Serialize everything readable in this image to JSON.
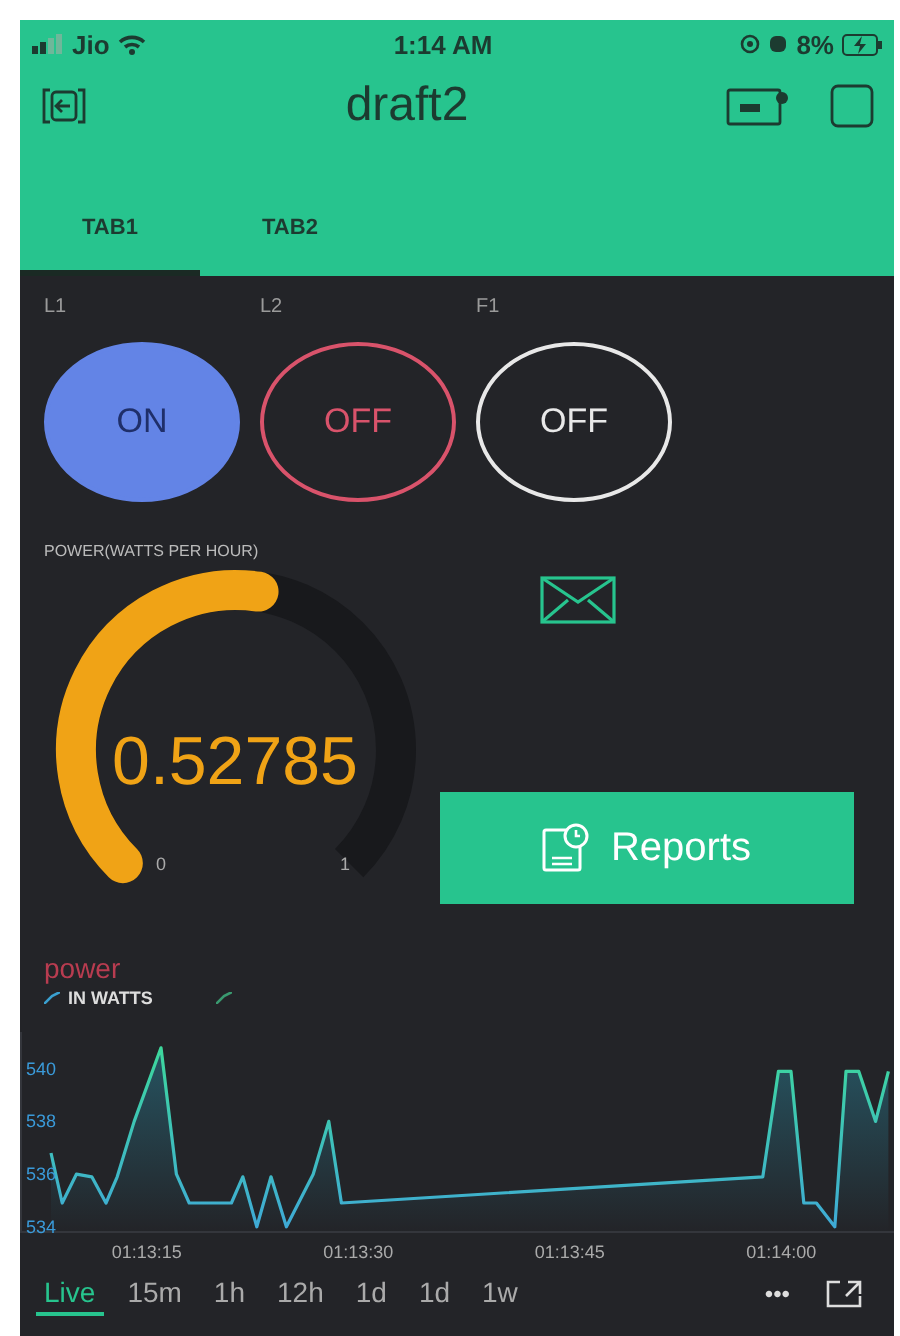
{
  "status_bar": {
    "carrier": "Jio",
    "time": "1:14 AM",
    "battery": "8%"
  },
  "header": {
    "title": "draft2"
  },
  "tabs": [
    {
      "label": "TAB1",
      "selected": true
    },
    {
      "label": "TAB2",
      "selected": false
    }
  ],
  "switches": [
    {
      "label": "L1",
      "value": "ON",
      "on": true,
      "color": "#6384e6"
    },
    {
      "label": "L2",
      "value": "OFF",
      "on": false,
      "color": "#d9536b"
    },
    {
      "label": "F1",
      "value": "OFF",
      "on": false,
      "color": "#e8e8e8"
    }
  ],
  "gauge": {
    "title": "POWER(WATTS PER HOUR)",
    "value": "0.52785",
    "min": "0",
    "max": "1"
  },
  "reports_button": {
    "label": "Reports"
  },
  "chart": {
    "title": "power",
    "chart_data": {
      "type": "area",
      "x": [
        4388.2,
        4389.0,
        4390.0,
        4391.1,
        4392.1,
        4392.9,
        4394.1,
        4396.0,
        4397.1,
        4398.0,
        4401.0,
        4401.8,
        4402.8,
        4403.8,
        4404.9,
        4406.8,
        4407.9,
        4408.8,
        4438.7,
        4439.8,
        4440.7,
        4441.6,
        4442.5,
        4443.8,
        4444.6,
        4445.5,
        4446.7,
        4447.6
      ],
      "series": [
        {
          "name": "IN WATTS",
          "color": "#3fa9d8",
          "values": [
            536.8,
            534.9,
            536.0,
            535.9,
            534.9,
            535.9,
            538.0,
            540.8,
            536.0,
            534.9,
            534.9,
            535.9,
            534.0,
            535.9,
            534.0,
            536.0,
            538.0,
            534.9,
            535.9,
            539.9,
            539.9,
            534.9,
            534.9,
            534.0,
            539.9,
            539.9,
            538.0,
            539.9
          ]
        }
      ],
      "xlim": [
        4386,
        4448
      ],
      "ylim": [
        533.8,
        541.4
      ],
      "xticks": [
        {
          "value": 4395,
          "label": "01:13:15"
        },
        {
          "value": 4410,
          "label": "01:13:30"
        },
        {
          "value": 4425,
          "label": "01:13:45"
        },
        {
          "value": 4440,
          "label": "01:14:00"
        }
      ],
      "yticks": [
        534,
        536,
        538,
        540
      ]
    }
  },
  "ranges": [
    {
      "label": "Live",
      "selected": true
    },
    {
      "label": "15m",
      "selected": false
    },
    {
      "label": "1h",
      "selected": false
    },
    {
      "label": "12h",
      "selected": false
    },
    {
      "label": "1d",
      "selected": false
    },
    {
      "label": "1d",
      "selected": false
    },
    {
      "label": "1w",
      "selected": false
    }
  ],
  "more": "•••"
}
